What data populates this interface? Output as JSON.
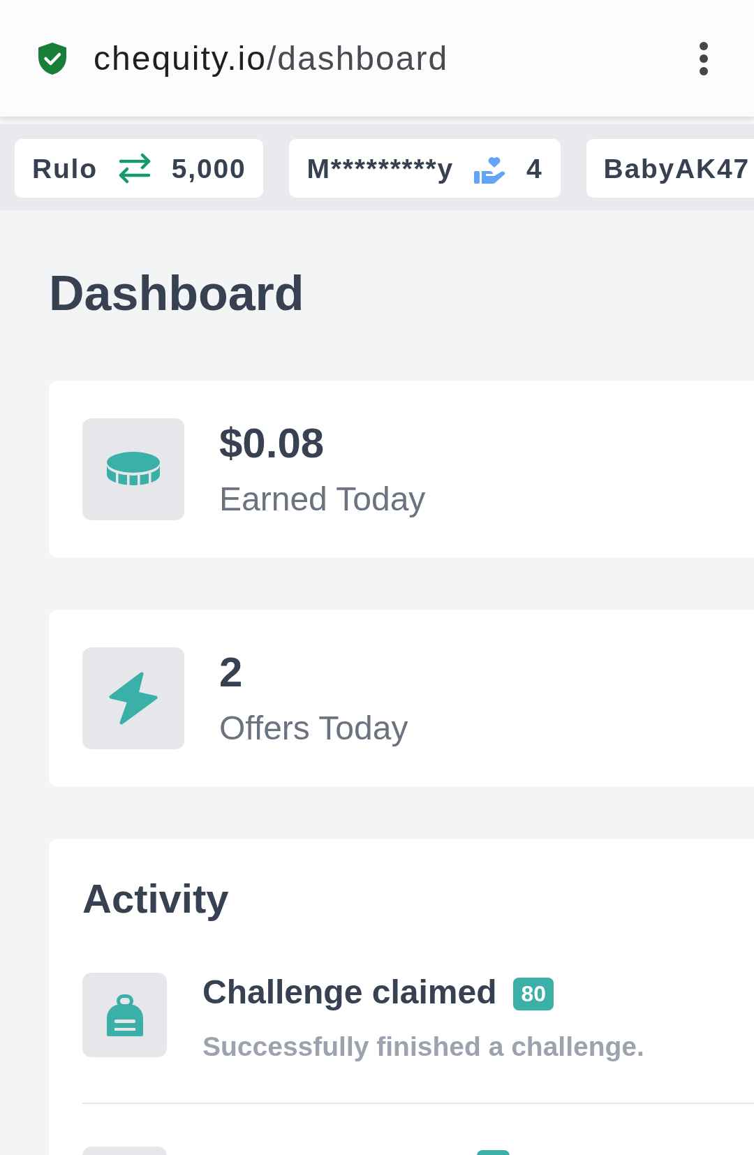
{
  "address_bar": {
    "host": "chequity.io",
    "path": "/dashboard"
  },
  "ticker": [
    {
      "user": "Rulo",
      "kind": "transfer",
      "amount": "5,000"
    },
    {
      "user": "M*********y",
      "kind": "gift",
      "amount": "4"
    },
    {
      "user": "BabyAK47"
    }
  ],
  "page_title": "Dashboard",
  "stats": [
    {
      "kind": "earned",
      "value": "$0.08",
      "label": "Earned Today"
    },
    {
      "kind": "offers",
      "value": "2",
      "label": "Offers Today"
    }
  ],
  "activity": {
    "title": "Activity",
    "items": [
      {
        "kind": "challenge",
        "title": "Challenge claimed",
        "points": "80",
        "description": "Successfully finished a challenge."
      },
      {
        "kind": "clipped"
      }
    ]
  }
}
